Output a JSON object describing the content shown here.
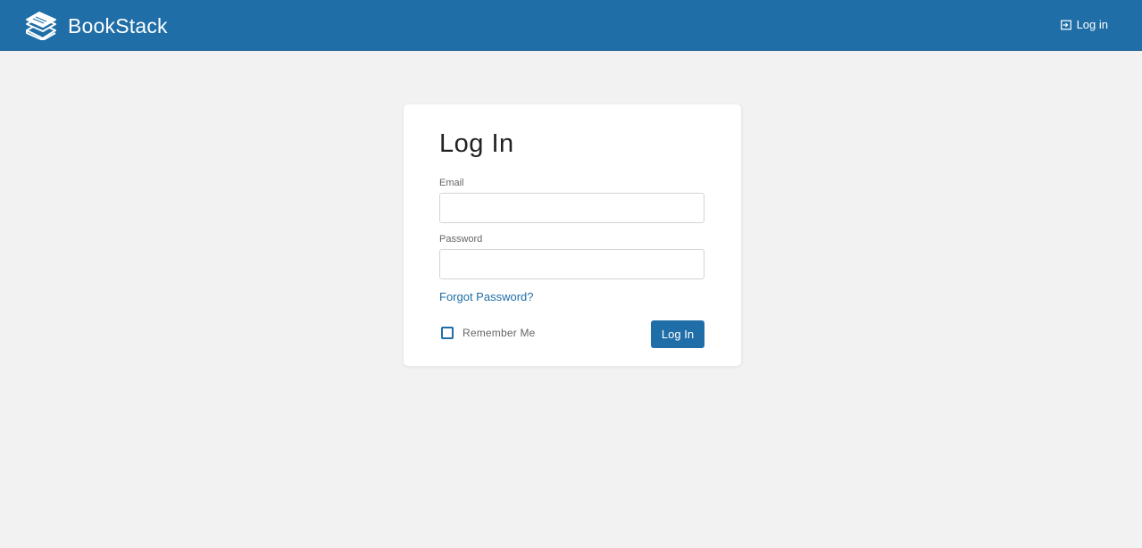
{
  "header": {
    "app_name": "BookStack",
    "logo_icon": "bookstack-logo-icon",
    "login_link": "Log in",
    "login_icon": "login-icon",
    "background_color": "#206ea7"
  },
  "login_form": {
    "title": "Log In",
    "email": {
      "label": "Email",
      "value": "",
      "placeholder": ""
    },
    "password": {
      "label": "Password",
      "value": "",
      "placeholder": ""
    },
    "forgot_password_link": "Forgot Password?",
    "remember_me": {
      "label": "Remember Me",
      "checked": false
    },
    "submit_label": "Log In",
    "accent_color": "#206ea7"
  }
}
